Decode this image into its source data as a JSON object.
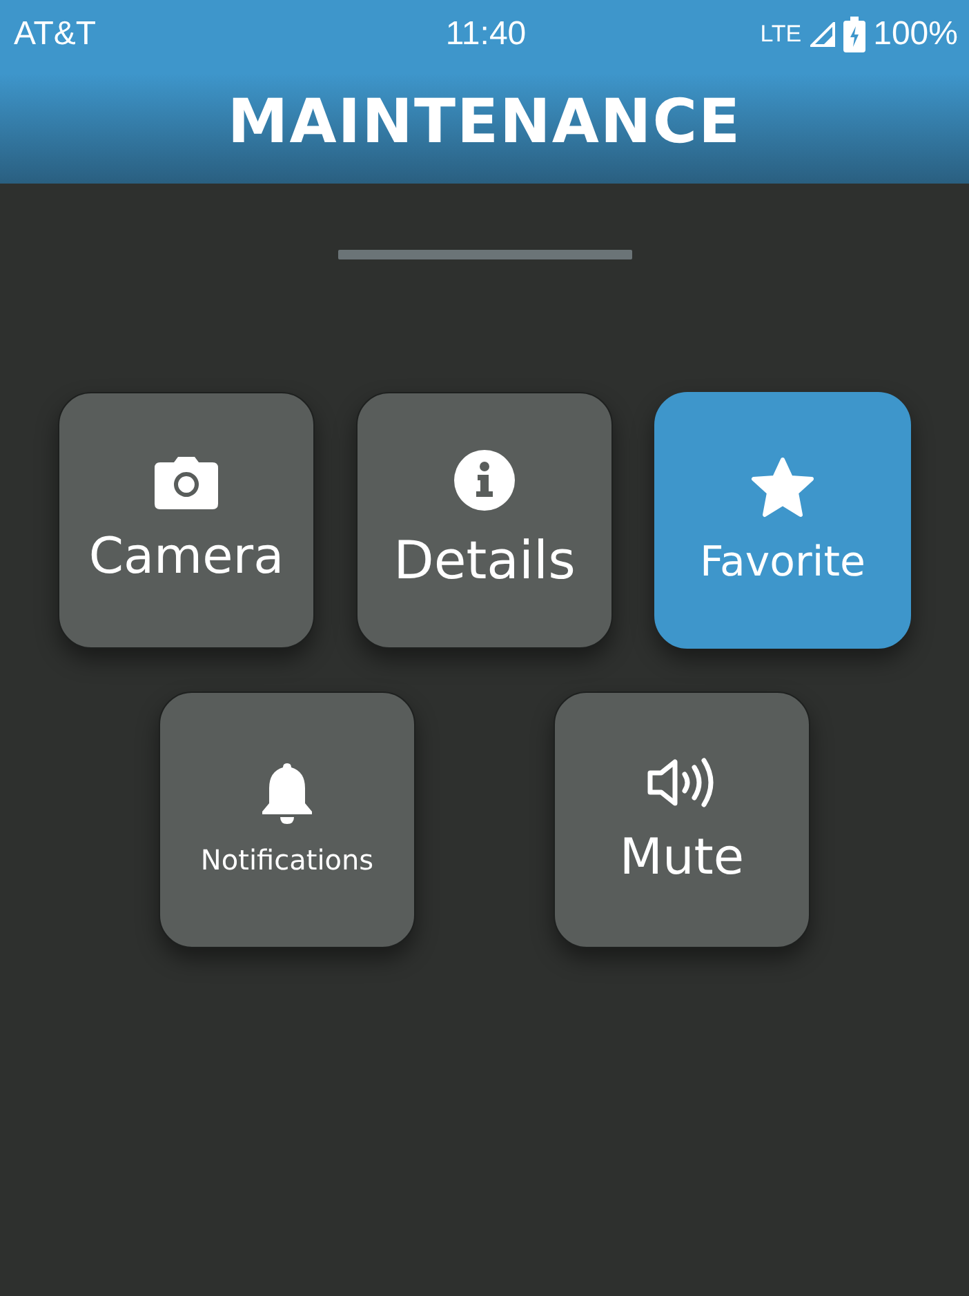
{
  "status_bar": {
    "carrier": "AT&T",
    "time": "11:40",
    "network": "LTE",
    "battery": "100%"
  },
  "header": {
    "title": "MAINTENANCE"
  },
  "rows": [
    [
      {
        "kind": "camera",
        "label": "Camera",
        "selected": false
      },
      {
        "kind": "info",
        "label": "Details",
        "selected": false
      },
      {
        "kind": "star",
        "label": "Favorite",
        "selected": true
      }
    ],
    [
      {
        "kind": "bell",
        "label": "Notifications",
        "selected": false
      },
      {
        "kind": "speaker",
        "label": "Mute",
        "selected": false
      }
    ]
  ]
}
